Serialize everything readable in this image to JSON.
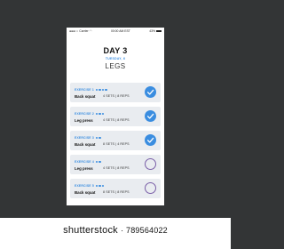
{
  "statusbar": {
    "carrier": "Carrier",
    "time": "00:00 AM EST",
    "battery": "43%"
  },
  "header": {
    "day": "DAY 3",
    "date": "TUESDAY, 6",
    "workout": "LEGS"
  },
  "exercises": [
    {
      "label": "EXERCISE 1",
      "name": "Back squat",
      "meta": "4 SETS | 8 REPS",
      "dots": 4,
      "done": true
    },
    {
      "label": "EXERCISE 2",
      "name": "Leg press",
      "meta": "4 SETS | 8 REPS",
      "dots": 3,
      "done": true
    },
    {
      "label": "EXERCISE 3",
      "name": "Back squat",
      "meta": "8 SETS | 4 REPS",
      "dots": 2,
      "done": true
    },
    {
      "label": "EXERCISE 4",
      "name": "Leg press",
      "meta": "4 SETS | 8 REPS",
      "dots": 2,
      "done": false
    },
    {
      "label": "EXERCISE 5",
      "name": "Back squat",
      "meta": "8 SETS | 8 REPS",
      "dots": 3,
      "done": false
    }
  ],
  "colors": {
    "accent": "#3a8de0",
    "background": "#333536",
    "row": "#e9ecf0",
    "open_circle": "#7a5fa8"
  },
  "footer": {
    "brand": "shutterstock",
    "id": "· 789564022"
  }
}
